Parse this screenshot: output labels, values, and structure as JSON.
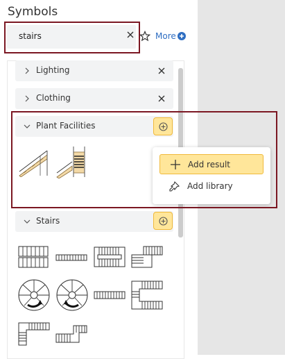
{
  "panel": {
    "title": "Symbols"
  },
  "search": {
    "value": "stairs"
  },
  "toolbar": {
    "more_label": "More"
  },
  "groups": [
    {
      "label": "Lighting",
      "expanded": false
    },
    {
      "label": "Clothing",
      "expanded": false
    },
    {
      "label": "Plant Facilities",
      "expanded": true
    },
    {
      "label": "Stairs",
      "expanded": true
    }
  ],
  "context_menu": {
    "items": [
      {
        "label": "Add result",
        "icon": "plus-icon"
      },
      {
        "label": "Add library",
        "icon": "pin-icon"
      }
    ]
  },
  "colors": {
    "accent_yellow": "#ffe69a",
    "highlight": "#7b1722",
    "link": "#2f6ec2"
  }
}
